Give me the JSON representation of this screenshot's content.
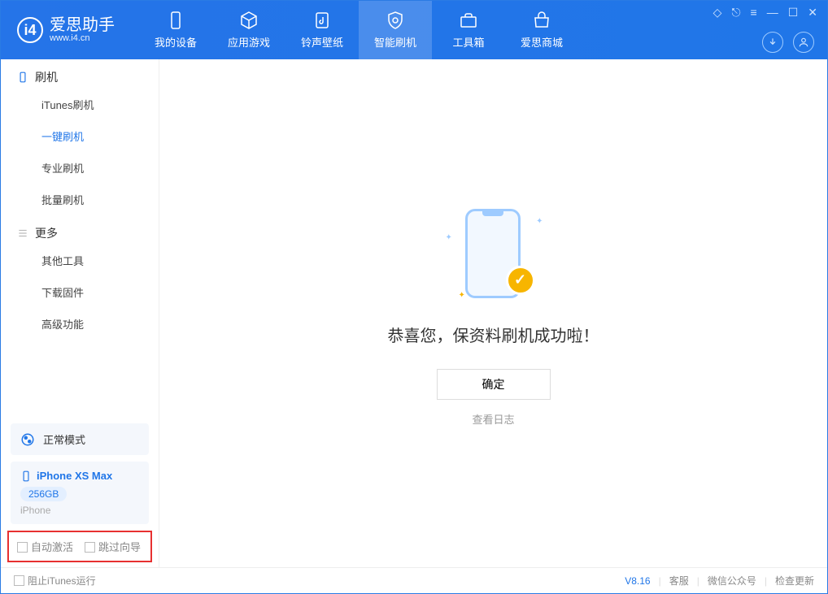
{
  "header": {
    "app_name": "爱思助手",
    "app_url": "www.i4.cn",
    "tabs": [
      {
        "label": "我的设备"
      },
      {
        "label": "应用游戏"
      },
      {
        "label": "铃声壁纸"
      },
      {
        "label": "智能刷机"
      },
      {
        "label": "工具箱"
      },
      {
        "label": "爱思商城"
      }
    ]
  },
  "sidebar": {
    "group1": "刷机",
    "items1": [
      "iTunes刷机",
      "一键刷机",
      "专业刷机",
      "批量刷机"
    ],
    "active1": 1,
    "group2": "更多",
    "items2": [
      "其他工具",
      "下载固件",
      "高级功能"
    ],
    "mode_label": "正常模式",
    "device_name": "iPhone XS Max",
    "device_storage": "256GB",
    "device_type": "iPhone",
    "checkbox1": "自动激活",
    "checkbox2": "跳过向导"
  },
  "main": {
    "success_message": "恭喜您，保资料刷机成功啦！",
    "ok_button": "确定",
    "view_log": "查看日志"
  },
  "footer": {
    "block_itunes": "阻止iTunes运行",
    "version": "V8.16",
    "support": "客服",
    "wechat": "微信公众号",
    "check_update": "检查更新"
  }
}
